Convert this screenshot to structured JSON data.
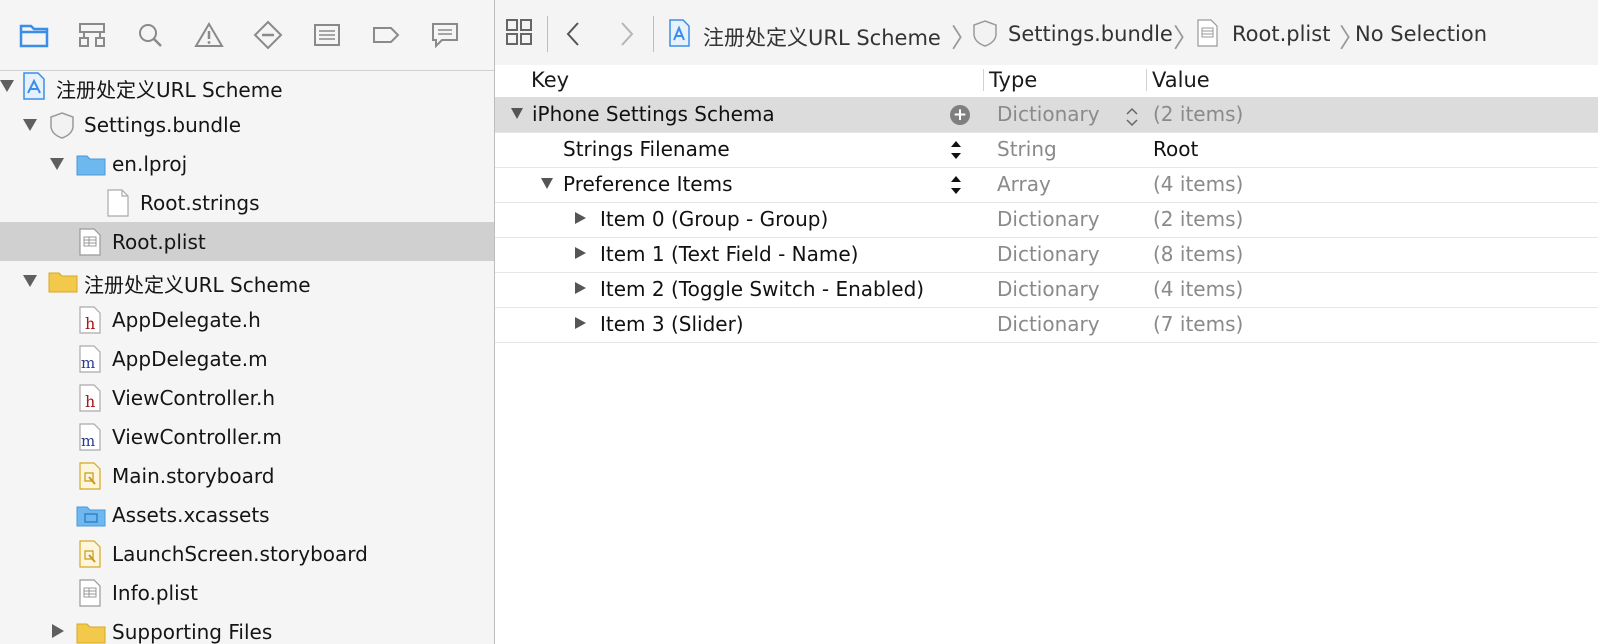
{
  "navigator": {
    "tabs": [
      "project-navigator",
      "symbol-navigator",
      "find-navigator",
      "issue-navigator",
      "test-navigator",
      "debug-navigator",
      "breakpoint-navigator",
      "report-navigator"
    ],
    "tree": [
      {
        "label": "注册处定义URL Scheme",
        "icon": "project-icon"
      },
      {
        "label": "Settings.bundle",
        "icon": "bundle-icon"
      },
      {
        "label": "en.lproj",
        "icon": "blue-folder-icon"
      },
      {
        "label": "Root.strings",
        "icon": "file-icon"
      },
      {
        "label": "Root.plist",
        "icon": "plist-icon"
      },
      {
        "label": "注册处定义URL Scheme",
        "icon": "yellow-folder-icon"
      },
      {
        "label": "AppDelegate.h",
        "icon": "header-file-icon"
      },
      {
        "label": "AppDelegate.m",
        "icon": "implementation-file-icon"
      },
      {
        "label": "ViewController.h",
        "icon": "header-file-icon"
      },
      {
        "label": "ViewController.m",
        "icon": "implementation-file-icon"
      },
      {
        "label": "Main.storyboard",
        "icon": "storyboard-icon"
      },
      {
        "label": "Assets.xcassets",
        "icon": "asset-catalog-icon"
      },
      {
        "label": "LaunchScreen.storyboard",
        "icon": "storyboard-icon"
      },
      {
        "label": "Info.plist",
        "icon": "plist-icon"
      },
      {
        "label": "Supporting Files",
        "icon": "yellow-folder-icon"
      }
    ]
  },
  "jumpbar": {
    "crumbs": [
      "注册处定义URL Scheme",
      "Settings.bundle",
      "Root.plist",
      "No Selection"
    ]
  },
  "plist": {
    "headers": {
      "key": "Key",
      "type": "Type",
      "value": "Value"
    },
    "rows": [
      {
        "key": "iPhone Settings Schema",
        "type": "Dictionary",
        "value": "(2 items)"
      },
      {
        "key": "Strings Filename",
        "type": "String",
        "value": "Root"
      },
      {
        "key": "Preference Items",
        "type": "Array",
        "value": "(4 items)"
      },
      {
        "key": "Item 0 (Group - Group)",
        "type": "Dictionary",
        "value": "(2 items)"
      },
      {
        "key": "Item 1 (Text Field - Name)",
        "type": "Dictionary",
        "value": "(8 items)"
      },
      {
        "key": "Item 2 (Toggle Switch - Enabled)",
        "type": "Dictionary",
        "value": "(4 items)"
      },
      {
        "key": "Item 3 (Slider)",
        "type": "Dictionary",
        "value": "(7 items)"
      }
    ]
  },
  "colors": {
    "accent": "#3b8ee8",
    "folder_yellow": "#f3c94b",
    "folder_blue": "#6cb8ef",
    "selection": "#d0d0d0"
  }
}
